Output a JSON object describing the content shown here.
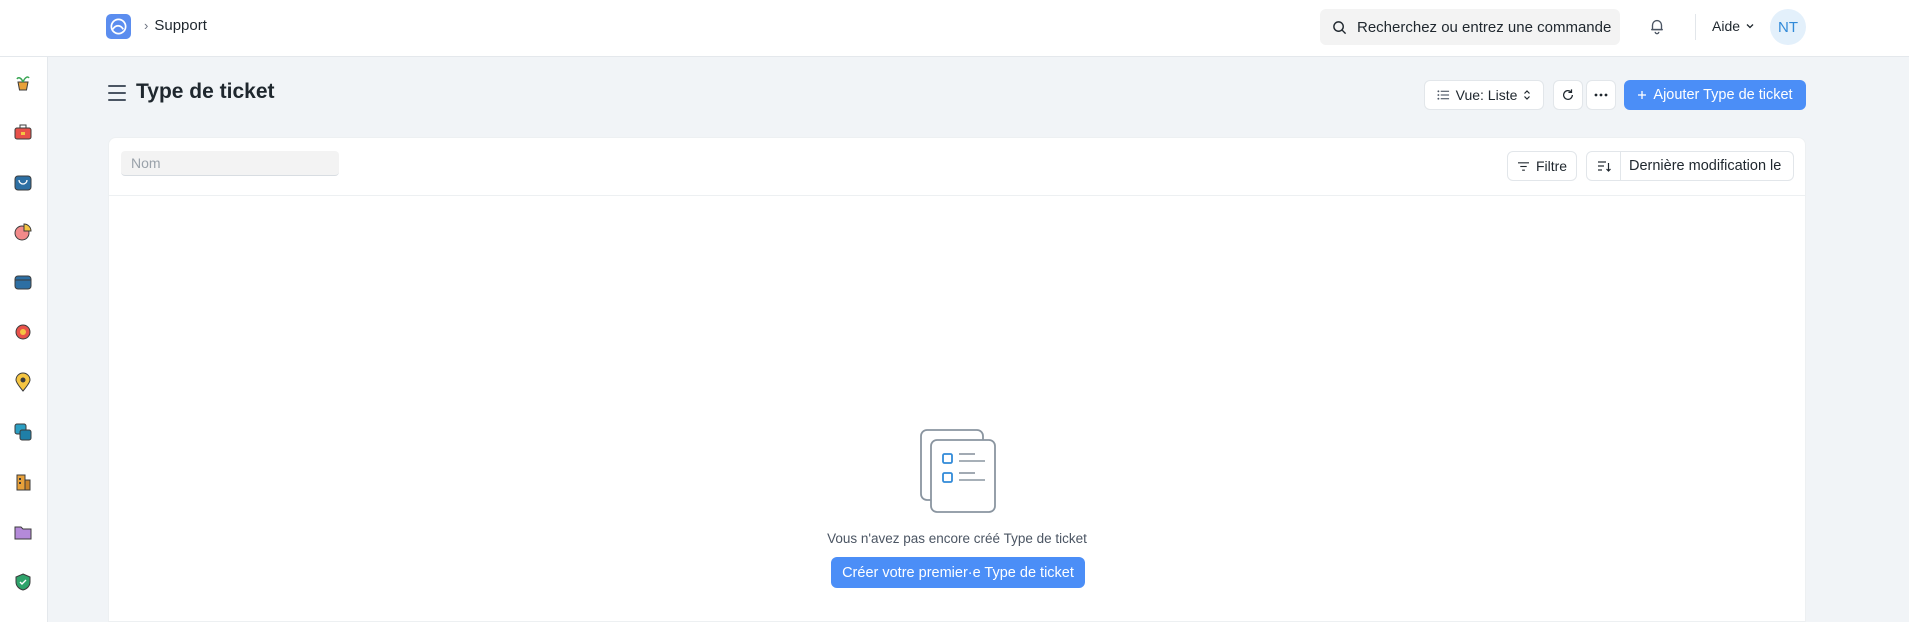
{
  "navbar": {
    "breadcrumb": "Support",
    "search_placeholder": "Recherchez ou entrez une commande",
    "help_label": "Aide",
    "avatar_initials": "NT"
  },
  "sidebar": {
    "icons": [
      "plant-pot-icon",
      "toolbox-icon",
      "shopping-bag-icon",
      "pie-chart-icon",
      "wallet-icon",
      "headset-icon",
      "map-pin-icon",
      "layers-icon",
      "buildings-icon",
      "folder-icon",
      "shield-icon"
    ]
  },
  "page": {
    "title": "Type de ticket",
    "view_label": "Vue: Liste",
    "add_button": "Ajouter Type de ticket"
  },
  "list": {
    "name_placeholder": "Nom",
    "filter_label": "Filtre",
    "sort_label": "Dernière modification le"
  },
  "empty_state": {
    "message": "Vous n'avez pas encore créé Type de ticket",
    "create_button": "Créer votre premier·e Type de ticket"
  },
  "colors": {
    "accent": "#4b8ef7",
    "background": "#f1f4f7"
  }
}
